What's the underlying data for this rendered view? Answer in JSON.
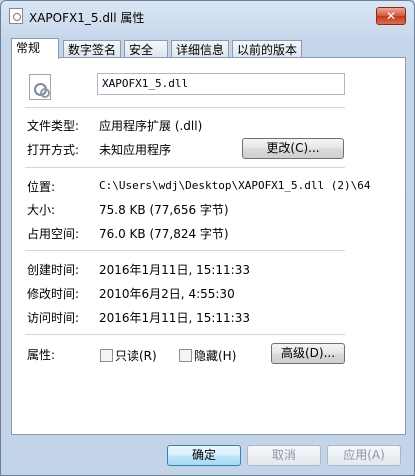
{
  "window": {
    "title": "XAPOFX1_5.dll 属性",
    "close_label": "✕"
  },
  "tabs": [
    {
      "label": "常规"
    },
    {
      "label": "数字签名"
    },
    {
      "label": "安全"
    },
    {
      "label": "详细信息"
    },
    {
      "label": "以前的版本"
    }
  ],
  "general": {
    "file_name": "XAPOFX1_5.dll",
    "file_type_label": "文件类型:",
    "file_type_value": "应用程序扩展 (.dll)",
    "opens_with_label": "打开方式:",
    "opens_with_value": "未知应用程序",
    "change_button": "更改(C)...",
    "location_label": "位置:",
    "location_value": "C:\\Users\\wdj\\Desktop\\XAPOFX1_5.dll (2)\\64",
    "size_label": "大小:",
    "size_value": "75.8 KB (77,656 字节)",
    "size_on_disk_label": "占用空间:",
    "size_on_disk_value": "76.0 KB (77,824 字节)",
    "created_label": "创建时间:",
    "created_value": "2016年1月11日, 15:11:33",
    "modified_label": "修改时间:",
    "modified_value": "2010年6月2日, 4:55:30",
    "accessed_label": "访问时间:",
    "accessed_value": "2016年1月11日, 15:11:33",
    "attributes_label": "属性:",
    "readonly_label": "只读(R)",
    "hidden_label": "隐藏(H)",
    "advanced_button": "高级(D)..."
  },
  "footer": {
    "ok": "确定",
    "cancel": "取消",
    "apply": "应用(A)"
  }
}
